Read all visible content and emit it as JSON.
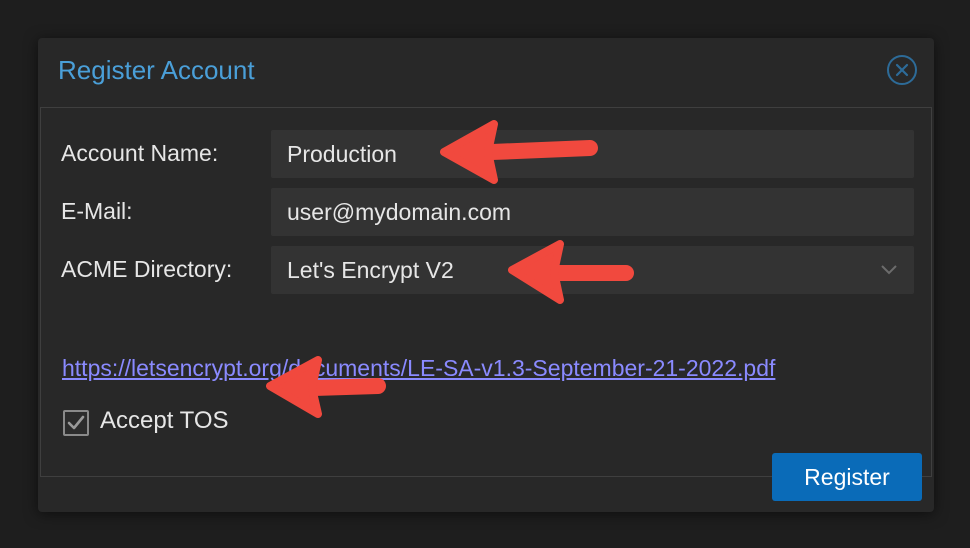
{
  "dialog": {
    "title": "Register Account",
    "close_icon": "close-icon"
  },
  "form": {
    "account_name": {
      "label": "Account Name:",
      "value": "Production"
    },
    "email": {
      "label": "E-Mail:",
      "value": "user@mydomain.com"
    },
    "acme_directory": {
      "label": "ACME Directory:",
      "value": "Let's Encrypt V2",
      "icon": "chevron-down-icon"
    },
    "tos_link": "https://letsencrypt.org/documents/LE-SA-v1.3-September-21-2022.pdf",
    "accept_tos": {
      "label": "Accept TOS",
      "checked": true
    }
  },
  "footer": {
    "register_label": "Register"
  },
  "colors": {
    "accent": "#4a9fd8",
    "button": "#0a6bb8",
    "link": "#8a8aff",
    "annotation_arrow": "#f1493e"
  }
}
